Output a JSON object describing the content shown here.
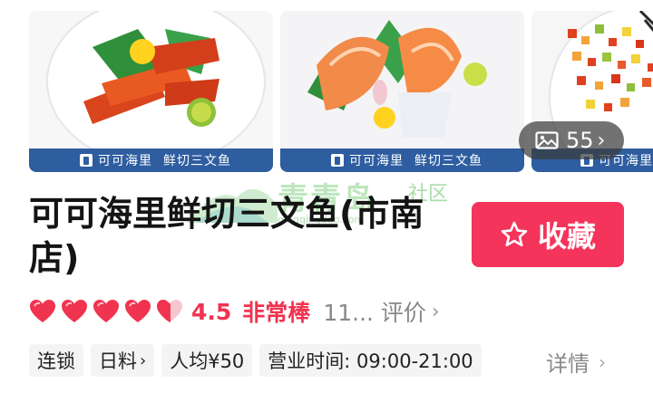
{
  "gallery": {
    "photos": [
      {
        "caption_brand": "可可海里",
        "caption_dish": "鲜切三文鱼"
      },
      {
        "caption_brand": "可可海里",
        "caption_dish": "鲜切三文鱼"
      },
      {
        "caption_brand": "可可海里",
        "caption_dish": ""
      }
    ],
    "photo_count": "55",
    "photo_count_icon": "image-icon"
  },
  "watermark": {
    "text": "青青岛",
    "suffix": "社区",
    "url": "qingqingdao.com"
  },
  "shop": {
    "title": "可可海里鲜切三文鱼(市南店)",
    "favorite_label": "收藏",
    "favorite_icon": "star-outline-icon"
  },
  "rating": {
    "hearts_full": 4,
    "hearts_partial": 0.5,
    "score": "4.5",
    "score_word": "非常棒",
    "reviews": "11... 评价",
    "heart_color": "#f0334f"
  },
  "tags": [
    {
      "label": "连锁",
      "has_chevron": false
    },
    {
      "label": "日料",
      "has_chevron": true
    },
    {
      "label": "人均¥50",
      "has_chevron": false
    },
    {
      "label": "营业时间: 09:00-21:00",
      "has_chevron": false
    }
  ],
  "details_label": "详情",
  "colors": {
    "accent": "#f5345b",
    "caption_bar": "#2e5da0"
  }
}
